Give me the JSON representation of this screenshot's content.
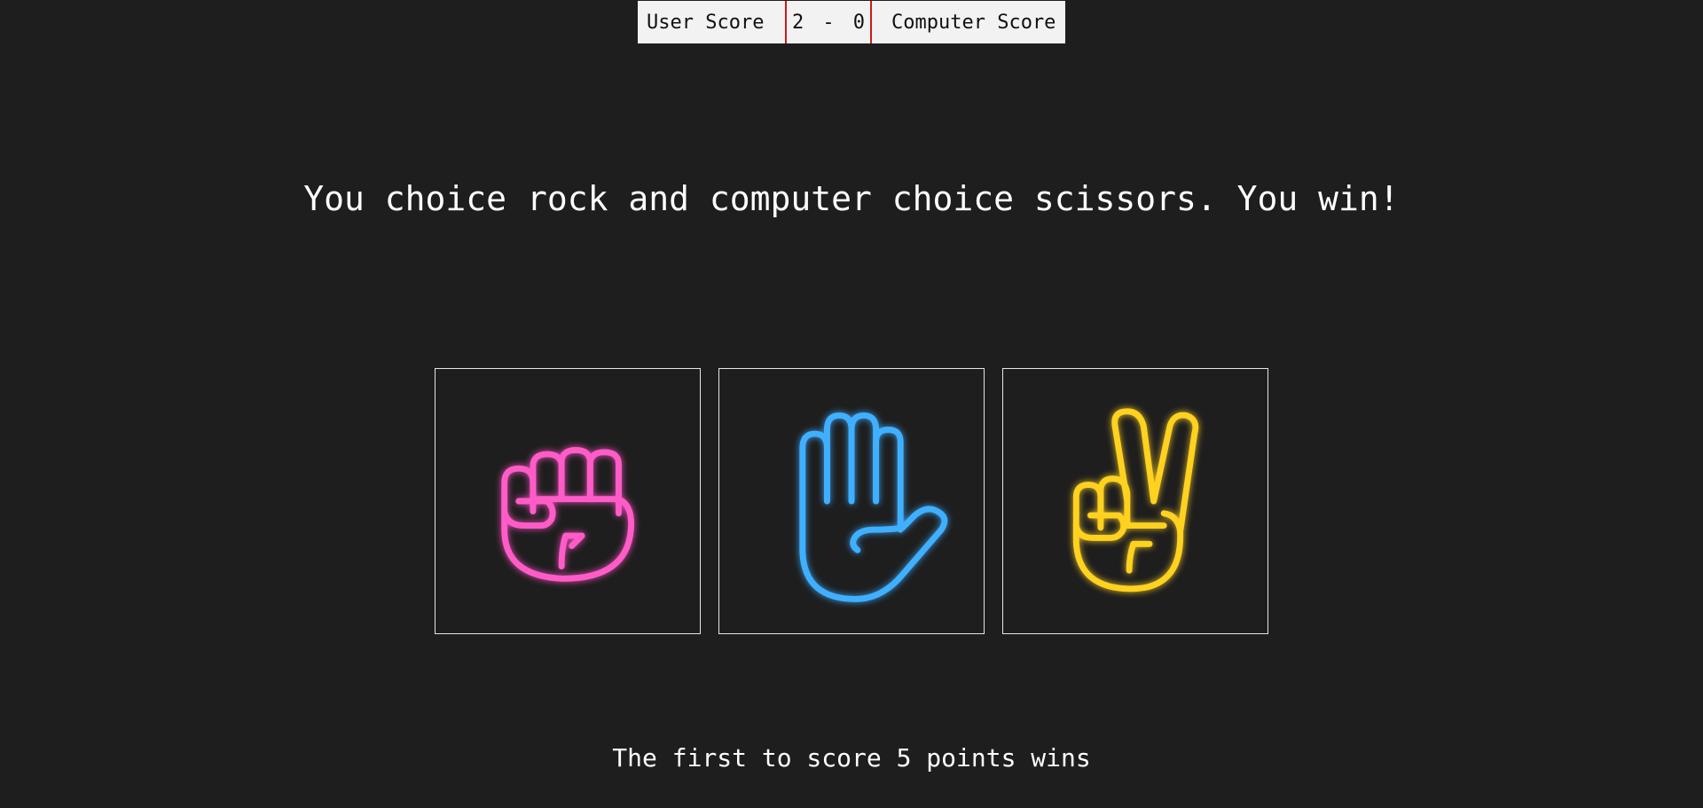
{
  "scoreboard": {
    "user_label": "User Score",
    "user_score": "2",
    "separator": "-",
    "computer_score": "0",
    "computer_label": "Computer Score"
  },
  "result_message": "You choice rock and computer choice scissors. You win!",
  "choices": [
    {
      "name": "rock",
      "icon": "fist-icon",
      "color": "#ff5cc8"
    },
    {
      "name": "paper",
      "icon": "open-hand-icon",
      "color": "#3fb0ff"
    },
    {
      "name": "scissors",
      "icon": "peace-hand-icon",
      "color": "#ffd21f"
    }
  ],
  "rules_text": "The first to score 5 points wins"
}
